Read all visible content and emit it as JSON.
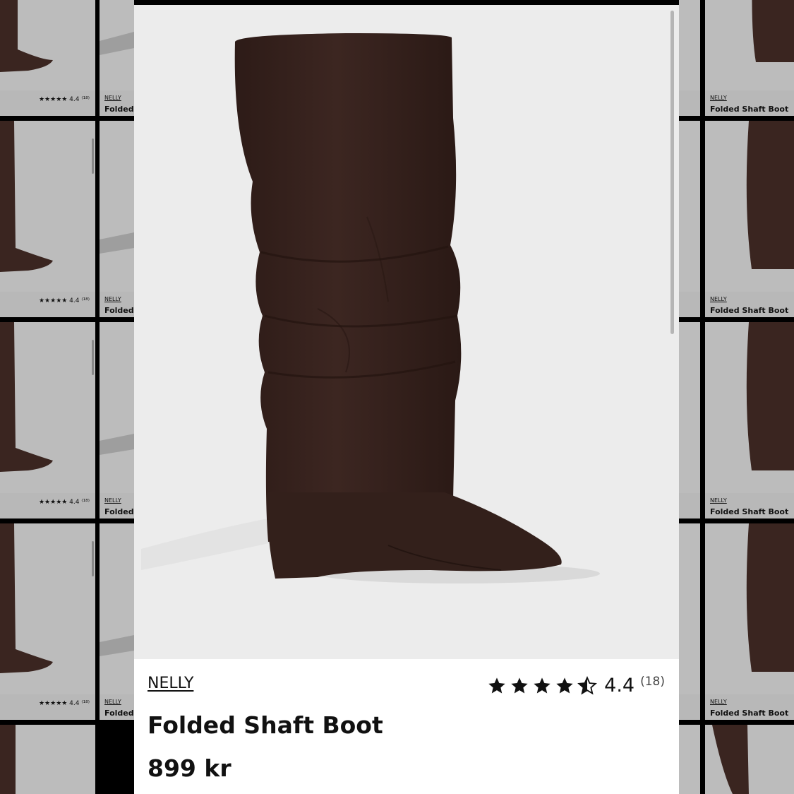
{
  "product": {
    "brand": "NELLY",
    "title": "Folded Shaft Boot",
    "price": "899 kr",
    "rating_value": "4.4",
    "rating_count": "(18)",
    "rating_stars": 4.4,
    "image_alt_icon": "boot-image"
  },
  "tiles": {
    "rating": "★★★★★ 4.4 ⁽¹⁸⁾",
    "brand": "NELLY",
    "title": "Folded Shaft Boot",
    "title_short": "Folded"
  },
  "colors": {
    "boot": "#3a2520",
    "background": "#000000",
    "card": "#ffffff",
    "image_bg": "#ececec"
  }
}
